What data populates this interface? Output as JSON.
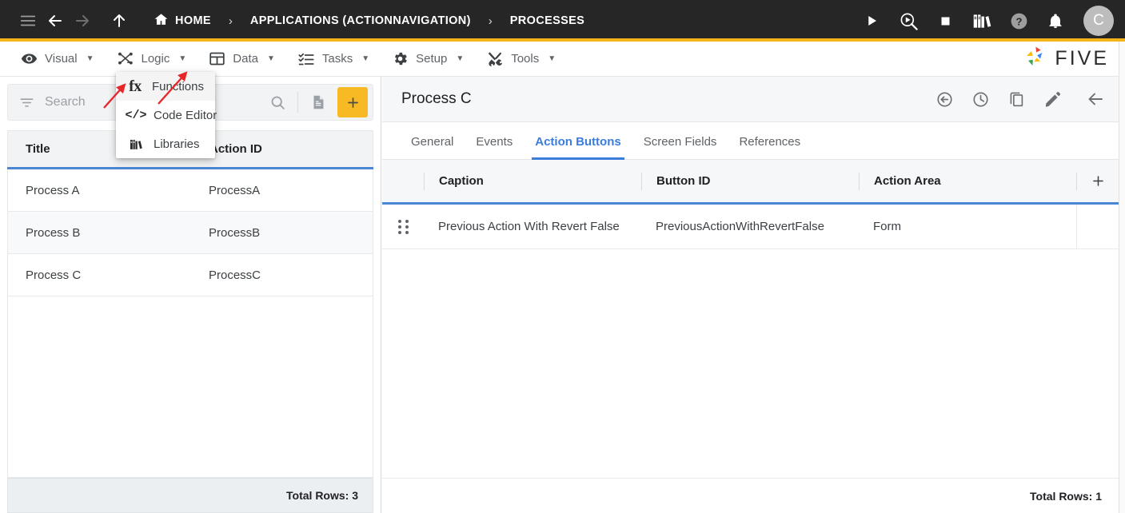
{
  "topbar": {
    "menu_icon": "hamburger-icon",
    "back_icon": "arrow-left-icon",
    "forward_icon": "arrow-right-icon",
    "up_icon": "arrow-up-icon",
    "breadcrumbs": [
      {
        "label": "HOME",
        "icon": "home-icon"
      },
      {
        "label": "APPLICATIONS (ACTIONNAVIGATION)",
        "icon": ""
      },
      {
        "label": "PROCESSES",
        "icon": ""
      }
    ],
    "separator": "›",
    "actions": [
      {
        "name": "run-icon",
        "title": "Run"
      },
      {
        "name": "debug-icon",
        "title": "Debug"
      },
      {
        "name": "stop-icon",
        "title": "Stop"
      },
      {
        "name": "library-icon",
        "title": "Library"
      },
      {
        "name": "help-icon",
        "title": "Help"
      },
      {
        "name": "notifications-icon",
        "title": "Notifications"
      }
    ],
    "avatar_initial": "C",
    "accent_color": "#f5b31b",
    "background": "#262626"
  },
  "menubar": {
    "items": [
      {
        "label": "Visual",
        "icon": "eye-icon",
        "caret": "▼"
      },
      {
        "label": "Logic",
        "icon": "logic-network-icon",
        "caret": "▼"
      },
      {
        "label": "Data",
        "icon": "grid-table-icon",
        "caret": "▼"
      },
      {
        "label": "Tasks",
        "icon": "task-list-icon",
        "caret": "▼"
      },
      {
        "label": "Setup",
        "icon": "gear-icon",
        "caret": "▼"
      },
      {
        "label": "Tools",
        "icon": "tools-icon",
        "caret": "▼"
      }
    ],
    "brand": "FIVE"
  },
  "dropdown": {
    "open_for": "Logic",
    "items": [
      {
        "label": "Functions",
        "icon": "fx-icon",
        "active": true
      },
      {
        "label": "Code Editor",
        "icon": "code-brackets-icon",
        "active": false
      },
      {
        "label": "Libraries",
        "icon": "books-icon",
        "active": false
      }
    ]
  },
  "left_panel": {
    "search": {
      "value": "",
      "placeholder": "Search",
      "filter_icon": "filter-icon",
      "search_icon": "search-icon"
    },
    "report_icon": "document-icon",
    "add_label": "+",
    "columns": [
      "Title",
      "Action ID"
    ],
    "rows": [
      {
        "title": "Process A",
        "action_id": "ProcessA"
      },
      {
        "title": "Process B",
        "action_id": "ProcessB"
      },
      {
        "title": "Process C",
        "action_id": "ProcessC"
      }
    ],
    "footer": "Total Rows: 3"
  },
  "right_panel": {
    "title": "Process C",
    "header_actions": [
      {
        "name": "revert-icon",
        "title": "Revert"
      },
      {
        "name": "history-clock-icon",
        "title": "History"
      },
      {
        "name": "duplicate-icon",
        "title": "Duplicate"
      },
      {
        "name": "edit-pencil-icon",
        "title": "Edit"
      },
      {
        "name": "close-back-arrow-icon",
        "title": "Back"
      }
    ],
    "tabs": [
      {
        "label": "General",
        "active": false
      },
      {
        "label": "Events",
        "active": false
      },
      {
        "label": "Action Buttons",
        "active": true
      },
      {
        "label": "Screen Fields",
        "active": false
      },
      {
        "label": "References",
        "active": false
      }
    ],
    "columns": [
      "Caption",
      "Button ID",
      "Action Area"
    ],
    "add_label": "+",
    "rows": [
      {
        "handle": "drag-handle-icon",
        "caption": "Previous Action With Revert False",
        "button_id": "PreviousActionWithRevertFalse",
        "action_area": "Form"
      }
    ],
    "footer": "Total Rows: 1"
  },
  "annotations": [
    {
      "name": "arrow-to-logic-menu",
      "color": "#e8262a"
    },
    {
      "name": "arrow-to-functions-item",
      "color": "#e8262a"
    }
  ],
  "colors": {
    "accent_yellow": "#f7b924",
    "active_blue": "#3b7ddd",
    "table_rule_blue": "#4a86d4",
    "annotation_red": "#e8262a"
  }
}
